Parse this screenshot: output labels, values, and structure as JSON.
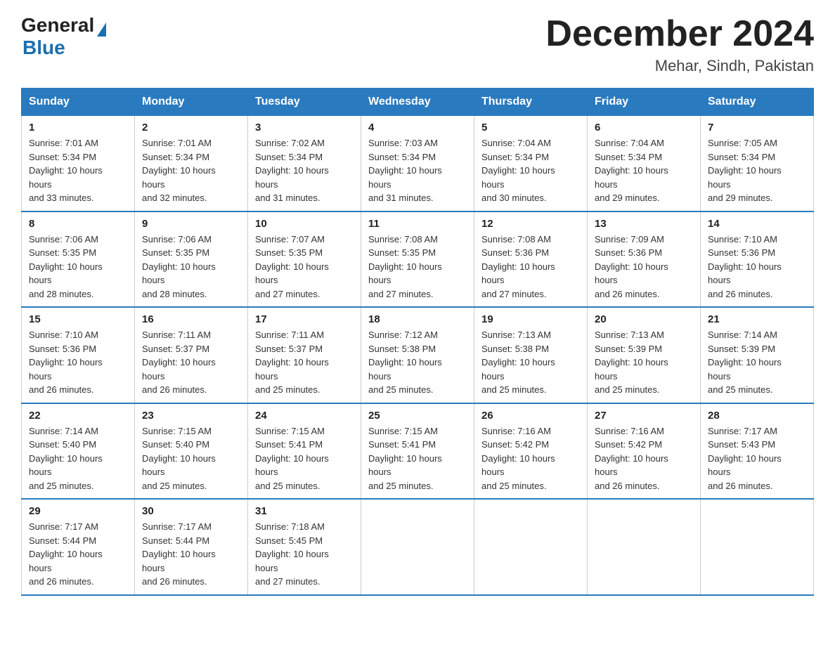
{
  "header": {
    "logo_general": "General",
    "logo_blue": "Blue",
    "title": "December 2024",
    "location": "Mehar, Sindh, Pakistan"
  },
  "days_of_week": [
    "Sunday",
    "Monday",
    "Tuesday",
    "Wednesday",
    "Thursday",
    "Friday",
    "Saturday"
  ],
  "weeks": [
    [
      {
        "day": "1",
        "sunrise": "7:01 AM",
        "sunset": "5:34 PM",
        "daylight": "10 hours and 33 minutes."
      },
      {
        "day": "2",
        "sunrise": "7:01 AM",
        "sunset": "5:34 PM",
        "daylight": "10 hours and 32 minutes."
      },
      {
        "day": "3",
        "sunrise": "7:02 AM",
        "sunset": "5:34 PM",
        "daylight": "10 hours and 31 minutes."
      },
      {
        "day": "4",
        "sunrise": "7:03 AM",
        "sunset": "5:34 PM",
        "daylight": "10 hours and 31 minutes."
      },
      {
        "day": "5",
        "sunrise": "7:04 AM",
        "sunset": "5:34 PM",
        "daylight": "10 hours and 30 minutes."
      },
      {
        "day": "6",
        "sunrise": "7:04 AM",
        "sunset": "5:34 PM",
        "daylight": "10 hours and 29 minutes."
      },
      {
        "day": "7",
        "sunrise": "7:05 AM",
        "sunset": "5:34 PM",
        "daylight": "10 hours and 29 minutes."
      }
    ],
    [
      {
        "day": "8",
        "sunrise": "7:06 AM",
        "sunset": "5:35 PM",
        "daylight": "10 hours and 28 minutes."
      },
      {
        "day": "9",
        "sunrise": "7:06 AM",
        "sunset": "5:35 PM",
        "daylight": "10 hours and 28 minutes."
      },
      {
        "day": "10",
        "sunrise": "7:07 AM",
        "sunset": "5:35 PM",
        "daylight": "10 hours and 27 minutes."
      },
      {
        "day": "11",
        "sunrise": "7:08 AM",
        "sunset": "5:35 PM",
        "daylight": "10 hours and 27 minutes."
      },
      {
        "day": "12",
        "sunrise": "7:08 AM",
        "sunset": "5:36 PM",
        "daylight": "10 hours and 27 minutes."
      },
      {
        "day": "13",
        "sunrise": "7:09 AM",
        "sunset": "5:36 PM",
        "daylight": "10 hours and 26 minutes."
      },
      {
        "day": "14",
        "sunrise": "7:10 AM",
        "sunset": "5:36 PM",
        "daylight": "10 hours and 26 minutes."
      }
    ],
    [
      {
        "day": "15",
        "sunrise": "7:10 AM",
        "sunset": "5:36 PM",
        "daylight": "10 hours and 26 minutes."
      },
      {
        "day": "16",
        "sunrise": "7:11 AM",
        "sunset": "5:37 PM",
        "daylight": "10 hours and 26 minutes."
      },
      {
        "day": "17",
        "sunrise": "7:11 AM",
        "sunset": "5:37 PM",
        "daylight": "10 hours and 25 minutes."
      },
      {
        "day": "18",
        "sunrise": "7:12 AM",
        "sunset": "5:38 PM",
        "daylight": "10 hours and 25 minutes."
      },
      {
        "day": "19",
        "sunrise": "7:13 AM",
        "sunset": "5:38 PM",
        "daylight": "10 hours and 25 minutes."
      },
      {
        "day": "20",
        "sunrise": "7:13 AM",
        "sunset": "5:39 PM",
        "daylight": "10 hours and 25 minutes."
      },
      {
        "day": "21",
        "sunrise": "7:14 AM",
        "sunset": "5:39 PM",
        "daylight": "10 hours and 25 minutes."
      }
    ],
    [
      {
        "day": "22",
        "sunrise": "7:14 AM",
        "sunset": "5:40 PM",
        "daylight": "10 hours and 25 minutes."
      },
      {
        "day": "23",
        "sunrise": "7:15 AM",
        "sunset": "5:40 PM",
        "daylight": "10 hours and 25 minutes."
      },
      {
        "day": "24",
        "sunrise": "7:15 AM",
        "sunset": "5:41 PM",
        "daylight": "10 hours and 25 minutes."
      },
      {
        "day": "25",
        "sunrise": "7:15 AM",
        "sunset": "5:41 PM",
        "daylight": "10 hours and 25 minutes."
      },
      {
        "day": "26",
        "sunrise": "7:16 AM",
        "sunset": "5:42 PM",
        "daylight": "10 hours and 25 minutes."
      },
      {
        "day": "27",
        "sunrise": "7:16 AM",
        "sunset": "5:42 PM",
        "daylight": "10 hours and 26 minutes."
      },
      {
        "day": "28",
        "sunrise": "7:17 AM",
        "sunset": "5:43 PM",
        "daylight": "10 hours and 26 minutes."
      }
    ],
    [
      {
        "day": "29",
        "sunrise": "7:17 AM",
        "sunset": "5:44 PM",
        "daylight": "10 hours and 26 minutes."
      },
      {
        "day": "30",
        "sunrise": "7:17 AM",
        "sunset": "5:44 PM",
        "daylight": "10 hours and 26 minutes."
      },
      {
        "day": "31",
        "sunrise": "7:18 AM",
        "sunset": "5:45 PM",
        "daylight": "10 hours and 27 minutes."
      },
      null,
      null,
      null,
      null
    ]
  ]
}
